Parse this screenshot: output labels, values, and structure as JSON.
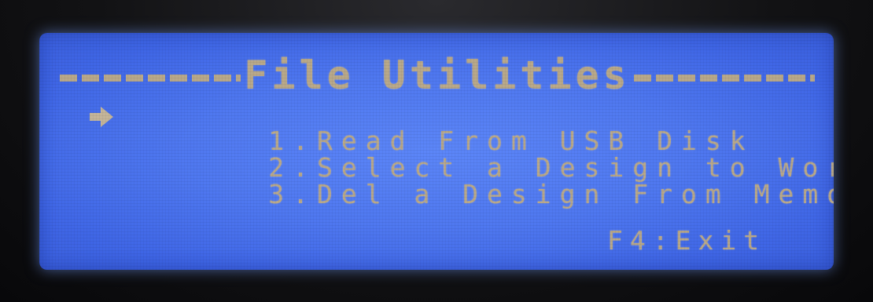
{
  "screen": {
    "title": "File Utilities",
    "menu": [
      {
        "number": "1.",
        "label": "Read From USB Disk",
        "selected": true
      },
      {
        "number": "2.",
        "label": "Select a Design to Work",
        "selected": false
      },
      {
        "number": "3.",
        "label": "Del a Design From Memory",
        "selected": false
      }
    ],
    "footer": "F4:Exit",
    "colors": {
      "background": "#4f78f0",
      "text": "#b9a98a"
    },
    "cursor_icon": "arrow-right-icon"
  }
}
